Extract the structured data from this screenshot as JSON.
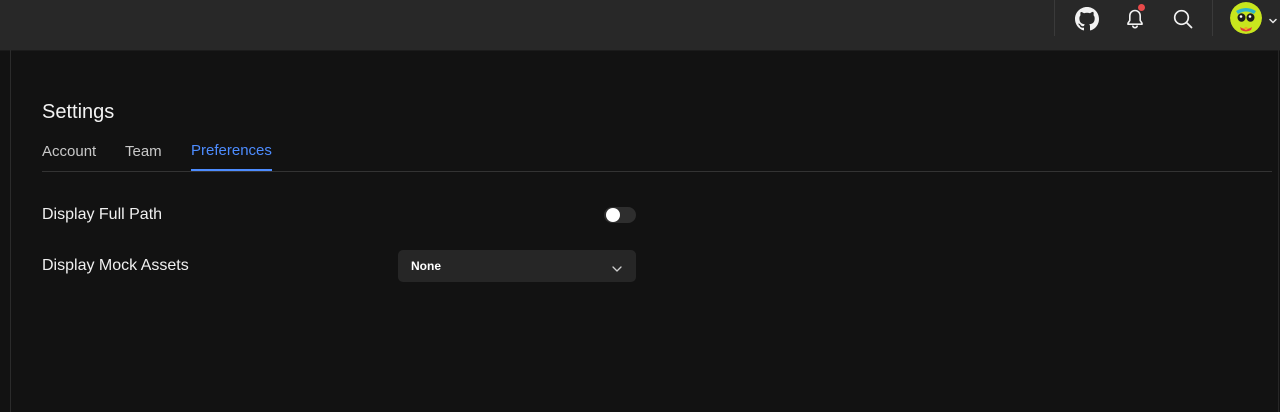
{
  "header": {
    "icons": [
      "github-icon",
      "bell-icon",
      "search-icon",
      "avatar",
      "chevron-down-icon"
    ],
    "has_notifications": true
  },
  "page": {
    "title": "Settings"
  },
  "tabs": [
    {
      "label": "Account",
      "active": false
    },
    {
      "label": "Team",
      "active": false
    },
    {
      "label": "Preferences",
      "active": true
    }
  ],
  "preferences": {
    "display_full_path": {
      "label": "Display Full Path",
      "enabled": false
    },
    "display_mock_assets": {
      "label": "Display Mock Assets",
      "value": "None"
    }
  },
  "colors": {
    "accent": "#4d8cff",
    "background": "#121212",
    "topbar": "#282828",
    "notification_dot": "#e84a4a"
  }
}
